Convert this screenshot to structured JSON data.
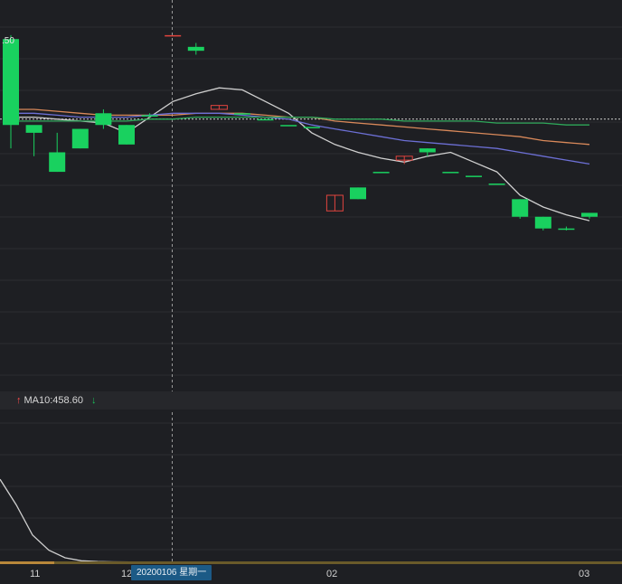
{
  "price_label": ".50",
  "indicator": {
    "ma10_label": "MA10:458.60",
    "arrow_up": "↑",
    "arrow_down": "↓"
  },
  "cursor_date_tag": "20200106 星期一",
  "colors": {
    "background": "#1e1f23",
    "grid": "#2c2d31",
    "up": "#e0443e",
    "down": "#19d15f",
    "ma_white": "#cfcfcf",
    "ma_orange": "#d9895a",
    "ma_purple": "#6c6fd4",
    "ma_green": "#2fa85a"
  },
  "chart_data": [
    {
      "type": "candlestick",
      "x_tick_labels": [
        "11",
        "12",
        "02",
        "03"
      ],
      "candles": [
        {
          "open": 466.0,
          "close": 463.8,
          "high": 466.1,
          "low": 463.2
        },
        {
          "open": 463.8,
          "close": 463.6,
          "high": 463.7,
          "low": 463.0
        },
        {
          "open": 463.1,
          "close": 462.6,
          "high": 463.6,
          "low": 462.6
        },
        {
          "open": 463.7,
          "close": 463.2,
          "high": 463.7,
          "low": 463.2
        },
        {
          "open": 464.1,
          "close": 463.8,
          "high": 464.2,
          "low": 463.7
        },
        {
          "open": 463.8,
          "close": 463.3,
          "high": 463.8,
          "low": 463.3
        },
        {
          "open": 464.05,
          "close": 464.05,
          "high": 464.1,
          "low": 464.0
        },
        {
          "open": 466.1,
          "close": 466.1,
          "high": 466.1,
          "low": 466.1
        },
        {
          "open": 465.8,
          "close": 465.7,
          "high": 465.9,
          "low": 465.6
        },
        {
          "open": 464.2,
          "close": 464.3,
          "high": 464.3,
          "low": 464.2
        },
        {
          "open": 464.1,
          "close": 464.1,
          "high": 464.1,
          "low": 464.1
        },
        {
          "open": 463.95,
          "close": 463.95,
          "high": 463.95,
          "low": 463.95
        },
        {
          "open": 463.8,
          "close": 463.8,
          "high": 463.8,
          "low": 463.8
        },
        {
          "open": 463.75,
          "close": 463.75,
          "high": 463.75,
          "low": 463.75
        },
        {
          "open": 461.6,
          "close": 462.0,
          "high": 462.0,
          "low": 461.6
        },
        {
          "open": 462.2,
          "close": 461.9,
          "high": 462.2,
          "low": 461.9
        },
        {
          "open": 462.6,
          "close": 462.6,
          "high": 462.6,
          "low": 462.6
        },
        {
          "open": 462.9,
          "close": 463.0,
          "high": 463.0,
          "low": 462.8
        },
        {
          "open": 463.2,
          "close": 463.1,
          "high": 463.2,
          "low": 463.0
        },
        {
          "open": 462.6,
          "close": 462.6,
          "high": 462.6,
          "low": 462.6
        },
        {
          "open": 462.5,
          "close": 462.5,
          "high": 462.5,
          "low": 462.5
        },
        {
          "open": 462.3,
          "close": 462.3,
          "high": 462.3,
          "low": 462.3
        },
        {
          "open": 461.9,
          "close": 461.45,
          "high": 461.9,
          "low": 461.4
        },
        {
          "open": 461.45,
          "close": 461.15,
          "high": 461.45,
          "low": 461.1
        },
        {
          "open": 461.15,
          "close": 461.15,
          "high": 461.2,
          "low": 461.1
        },
        {
          "open": 461.55,
          "close": 461.45,
          "high": 461.55,
          "low": 461.4
        }
      ],
      "ma_lines": [
        {
          "color": "#cfcfcf",
          "values": [
            464.0,
            464.0,
            463.95,
            463.9,
            463.85,
            463.6,
            464.0,
            464.4,
            464.6,
            464.75,
            464.7,
            464.4,
            464.1,
            463.6,
            463.3,
            463.1,
            462.95,
            462.85,
            463.0,
            463.1,
            462.85,
            462.6,
            462.0,
            461.7,
            461.5,
            461.35
          ]
        },
        {
          "color": "#d9895a",
          "values": [
            464.2,
            464.2,
            464.15,
            464.1,
            464.05,
            464.05,
            464.05,
            464.05,
            464.1,
            464.1,
            464.1,
            464.05,
            464.0,
            464.0,
            463.9,
            463.85,
            463.8,
            463.75,
            463.7,
            463.65,
            463.6,
            463.55,
            463.5,
            463.4,
            463.35,
            463.3
          ]
        },
        {
          "color": "#6c6fd4",
          "values": [
            464.1,
            464.1,
            464.05,
            464.0,
            464.0,
            464.0,
            464.05,
            464.1,
            464.1,
            464.1,
            464.05,
            464.0,
            463.95,
            463.8,
            463.7,
            463.6,
            463.5,
            463.4,
            463.35,
            463.3,
            463.25,
            463.2,
            463.1,
            463.0,
            462.9,
            462.8
          ]
        },
        {
          "color": "#2fa85a",
          "values": [
            463.9,
            463.9,
            463.9,
            463.9,
            463.9,
            463.9,
            463.95,
            463.95,
            464.0,
            464.0,
            464.0,
            464.0,
            464.0,
            464.0,
            463.95,
            463.95,
            463.95,
            463.9,
            463.9,
            463.9,
            463.9,
            463.85,
            463.85,
            463.85,
            463.8,
            463.8
          ]
        }
      ],
      "reference_price": 463.95,
      "ylim": [
        457.0,
        467.0
      ]
    },
    {
      "type": "line",
      "name": "MA10",
      "value": 458.6,
      "values": [
        55,
        38,
        18,
        8,
        3,
        1,
        0.5,
        0.3,
        0.2,
        0.2
      ],
      "ylim": [
        0,
        100
      ]
    }
  ]
}
